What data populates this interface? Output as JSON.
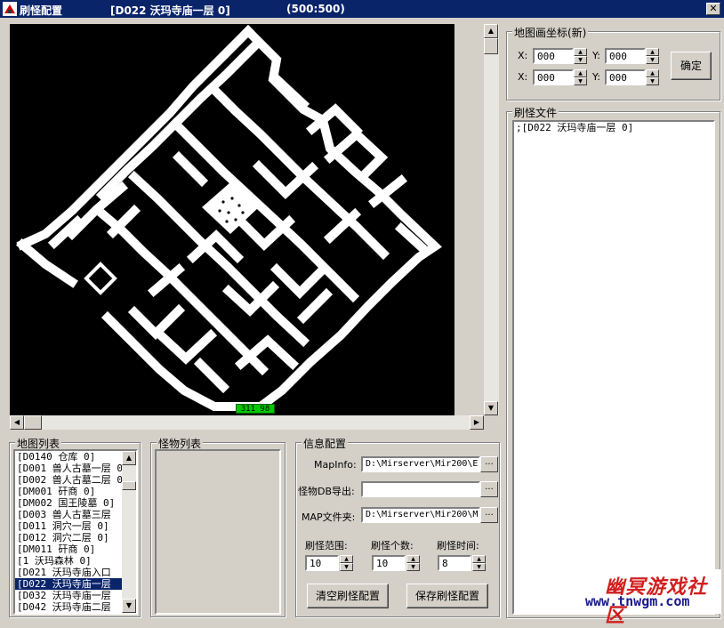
{
  "window": {
    "app_title": "刷怪配置",
    "map_title": "[D022  沃玛寺庙一层 0]",
    "map_size": "(500:500)",
    "close_label": "✕"
  },
  "map": {
    "coord_readout": "311  98"
  },
  "coords": {
    "group_title": "地图画坐标(新)",
    "x1_label": "X:",
    "x1_value": "000",
    "y1_label": "Y:",
    "y1_value": "000",
    "x2_label": "X:",
    "x2_value": "000",
    "y2_label": "Y:",
    "y2_value": "000",
    "confirm_label": "确定"
  },
  "spawn_file": {
    "group_title": "刷怪文件",
    "content": ";[D022  沃玛寺庙一层 0]"
  },
  "map_list": {
    "group_title": "地图列表",
    "items": [
      "[D0140 仓库 0]",
      "[D001 兽人古墓一层 0",
      "[D002 兽人古墓二层 0",
      "[DM001 矸商 0]",
      "[DM002 国王陵墓 0]",
      "[D003  兽人古墓三层",
      "[D011  洞穴一层 0]",
      "[D012  洞穴二层 0]",
      "[DM011 矸商 0]",
      "[1 沃玛森林 0]",
      "[D021  沃玛寺庙入口",
      "[D022  沃玛寺庙一层",
      "[D032  沃玛寺庙一层",
      "[D042  沃玛寺庙二层"
    ],
    "selected_index": 11
  },
  "monster_list": {
    "group_title": "怪物列表"
  },
  "info": {
    "group_title": "信息配置",
    "mapinfo_label": "MapInfo:",
    "mapinfo_value": "D:\\Mirserver\\Mir200\\En",
    "monsterdb_label": "怪物DB导出:",
    "monsterdb_value": "",
    "mapdir_label": "MAP文件夹:",
    "mapdir_value": "D:\\Mirserver\\Mir200\\Ma",
    "browse_label": "...",
    "range_label": "刷怪范围:",
    "range_value": "10",
    "count_label": "刷怪个数:",
    "count_value": "10",
    "time_label": "刷怪时间:",
    "time_value": "8",
    "clear_label": "清空刷怪配置",
    "save_label": "保存刷怪配置"
  },
  "watermark": {
    "cn": "幽冥游戏社区",
    "url": "www.tnwgm.com"
  }
}
